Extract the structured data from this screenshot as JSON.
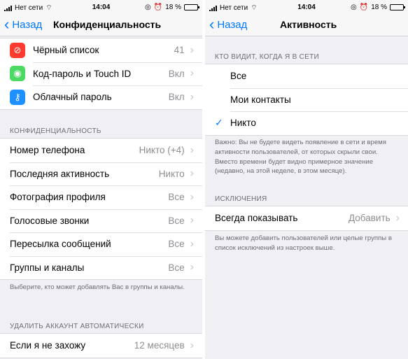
{
  "left": {
    "status": {
      "carrier": "Нет сети",
      "time": "14:04",
      "battery": "18 %",
      "battery_level": 0.18
    },
    "nav": {
      "back": "Назад",
      "title": "Конфиденциальность"
    },
    "top_items": [
      {
        "label": "Чёрный список",
        "value": "41",
        "icon": "block-icon",
        "color": "#ff3b30"
      },
      {
        "label": "Код-пароль и Touch ID",
        "value": "Вкл",
        "icon": "fingerprint-icon",
        "color": "#4cd964"
      },
      {
        "label": "Облачный пароль",
        "value": "Вкл",
        "icon": "key-icon",
        "color": "#1e90ff"
      }
    ],
    "privacy_header": "КОНФИДЕНЦИАЛЬНОСТЬ",
    "privacy_items": [
      {
        "label": "Номер телефона",
        "value": "Никто (+4)"
      },
      {
        "label": "Последняя активность",
        "value": "Никто"
      },
      {
        "label": "Фотография профиля",
        "value": "Все"
      },
      {
        "label": "Голосовые звонки",
        "value": "Все"
      },
      {
        "label": "Пересылка сообщений",
        "value": "Все"
      },
      {
        "label": "Группы и каналы",
        "value": "Все"
      }
    ],
    "privacy_footer": "Выберите, кто может добавлять Вас в группы и каналы.",
    "delete_header": "УДАЛИТЬ АККАУНТ АВТОМАТИЧЕСКИ",
    "delete_item": {
      "label": "Если я не захожу",
      "value": "12 месяцев"
    }
  },
  "right": {
    "status": {
      "carrier": "Нет сети",
      "time": "14:04",
      "battery": "18 %",
      "battery_level": 0.18
    },
    "nav": {
      "back": "Назад",
      "title": "Активность"
    },
    "who_header": "КТО ВИДИТ, КОГДА Я В СЕТИ",
    "options": [
      {
        "label": "Все",
        "selected": false
      },
      {
        "label": "Мои контакты",
        "selected": false
      },
      {
        "label": "Никто",
        "selected": true
      }
    ],
    "check_mark": "✓",
    "who_footer": "Важно: Вы не будете видеть появление в сети и время активности пользователей, от которых скрыли свои. Вместо времени будет видно примерное значение (недавно, на этой неделе, в этом месяце).",
    "exceptions_header": "ИСКЛЮЧЕНИЯ",
    "always_show": {
      "label": "Всегда показывать",
      "value": "Добавить"
    },
    "exceptions_footer": "Вы можете добавить пользователей или целые группы в список исключений из настроек выше."
  }
}
